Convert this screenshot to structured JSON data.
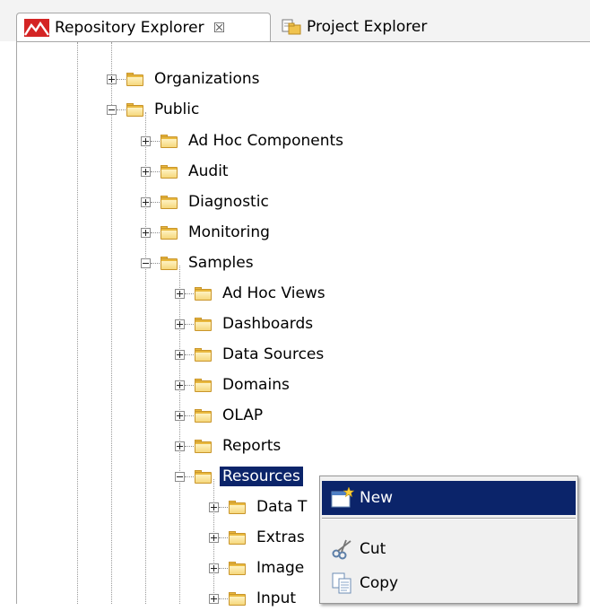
{
  "tabs": [
    {
      "label": "Repository Explorer",
      "active": true,
      "close_glyph": "☒",
      "icon": "jaspersoft-mountain-icon"
    },
    {
      "label": "Project Explorer",
      "active": false,
      "icon": "project-explorer-icon"
    }
  ],
  "tree": {
    "nodes": [
      {
        "label": "Organizations",
        "expanded": false,
        "level": 0
      },
      {
        "label": "Public",
        "expanded": true,
        "level": 0
      },
      {
        "label": "Ad Hoc Components",
        "expanded": false,
        "level": 1
      },
      {
        "label": "Audit",
        "expanded": false,
        "level": 1
      },
      {
        "label": "Diagnostic",
        "expanded": false,
        "level": 1
      },
      {
        "label": "Monitoring",
        "expanded": false,
        "level": 1
      },
      {
        "label": "Samples",
        "expanded": true,
        "level": 1
      },
      {
        "label": "Ad Hoc Views",
        "expanded": false,
        "level": 2
      },
      {
        "label": "Dashboards",
        "expanded": false,
        "level": 2
      },
      {
        "label": "Data Sources",
        "expanded": false,
        "level": 2
      },
      {
        "label": "Domains",
        "expanded": false,
        "level": 2
      },
      {
        "label": "OLAP",
        "expanded": false,
        "level": 2
      },
      {
        "label": "Reports",
        "expanded": false,
        "level": 2
      },
      {
        "label": "Resources",
        "expanded": true,
        "level": 2,
        "selected": true
      },
      {
        "label": "Data T",
        "expanded": false,
        "level": 3
      },
      {
        "label": "Extras",
        "expanded": false,
        "level": 3
      },
      {
        "label": "Image",
        "expanded": false,
        "level": 3
      },
      {
        "label": "Input",
        "expanded": false,
        "level": 3
      }
    ]
  },
  "context_menu": {
    "items": [
      {
        "label": "New",
        "icon": "new-icon",
        "highlighted": true
      },
      {
        "label": "Cut",
        "icon": "scissors-icon",
        "highlighted": false
      },
      {
        "label": "Copy",
        "icon": "copy-icon",
        "highlighted": false
      }
    ]
  },
  "colors": {
    "selection": "#0b246a",
    "folder": "#e9b93f",
    "menu_background": "#f0f0f0"
  }
}
